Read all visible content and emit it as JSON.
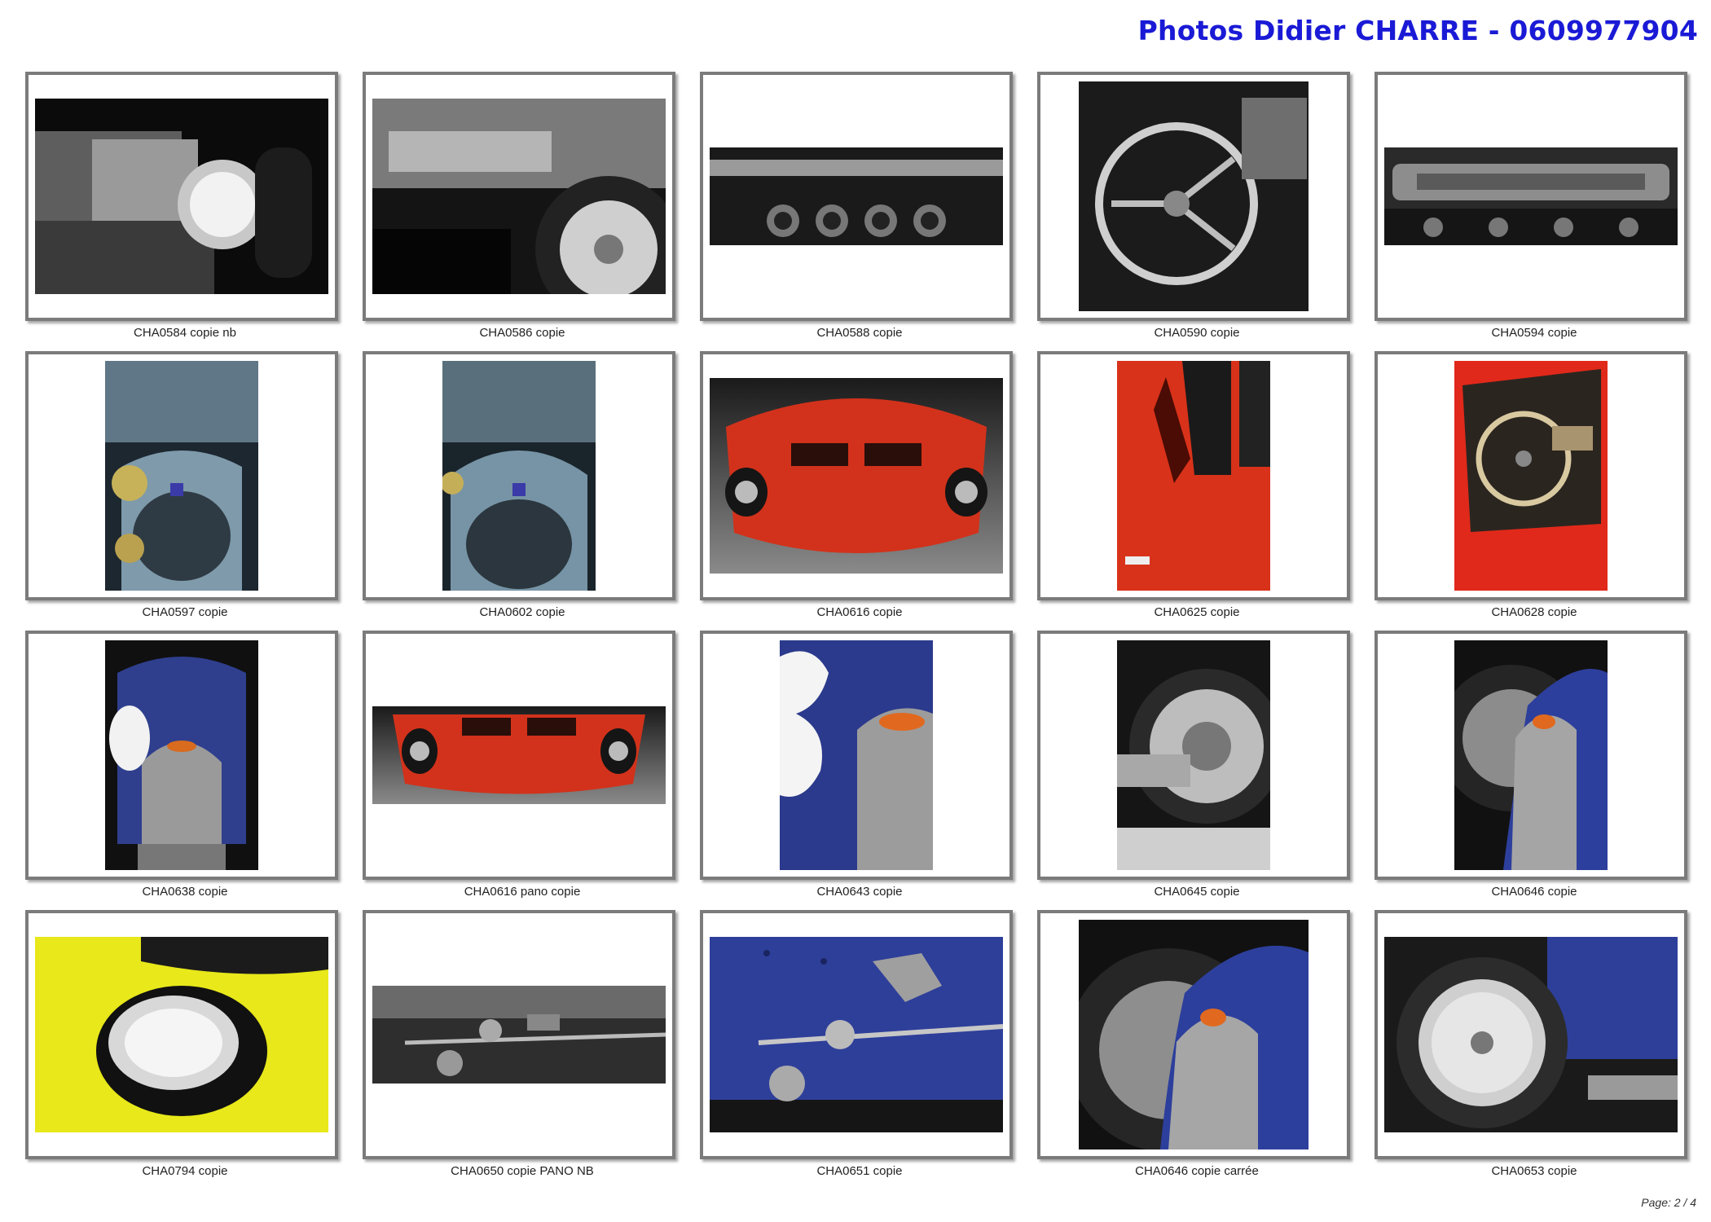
{
  "header": {
    "title": "Photos Didier CHARRE - 0609977904"
  },
  "photos": [
    {
      "caption": "CHA0584 copie nb"
    },
    {
      "caption": "CHA0586 copie"
    },
    {
      "caption": "CHA0588 copie"
    },
    {
      "caption": "CHA0590 copie"
    },
    {
      "caption": "CHA0594 copie"
    },
    {
      "caption": "CHA0597 copie"
    },
    {
      "caption": "CHA0602 copie"
    },
    {
      "caption": "CHA0616  copie"
    },
    {
      "caption": "CHA0625 copie"
    },
    {
      "caption": "CHA0628 copie"
    },
    {
      "caption": "CHA0638 copie"
    },
    {
      "caption": "CHA0616 pano copie"
    },
    {
      "caption": "CHA0643 copie"
    },
    {
      "caption": "CHA0645 copie"
    },
    {
      "caption": "CHA0646 copie"
    },
    {
      "caption": "CHA0794 copie"
    },
    {
      "caption": "CHA0650 copie PANO NB"
    },
    {
      "caption": "CHA0651 copie"
    },
    {
      "caption": "CHA0646 copie carrée"
    },
    {
      "caption": "CHA0653 copie"
    }
  ],
  "footer": {
    "page": "Page: 2 / 4"
  }
}
